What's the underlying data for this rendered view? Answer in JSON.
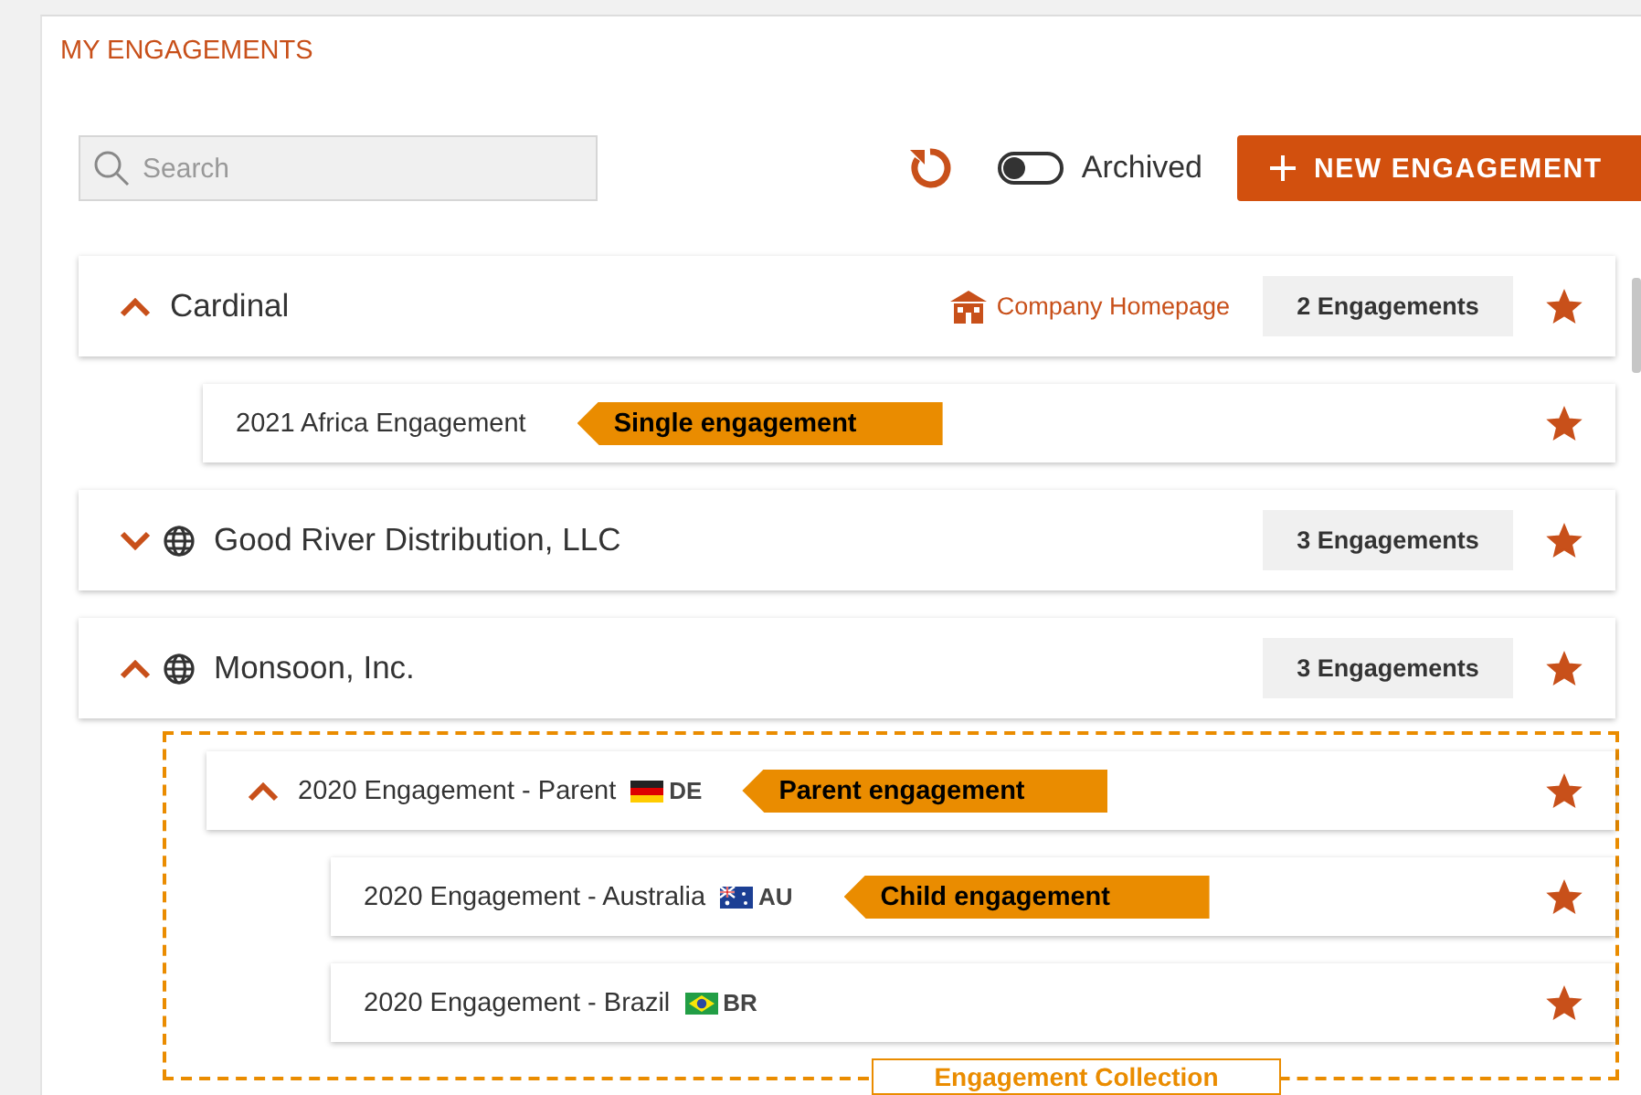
{
  "title": "MY ENGAGEMENTS",
  "toolbar": {
    "search": {
      "placeholder": "Search"
    },
    "archived": {
      "label": "Archived",
      "on": false
    },
    "new_button": "NEW ENGAGEMENT"
  },
  "companies": [
    {
      "name": "Cardinal",
      "expanded": true,
      "globe": false,
      "homepage": "Company Homepage",
      "count": "2 Engagements",
      "starred": true,
      "grouped": false,
      "engagements": [
        {
          "name": "2021 Africa Engagement",
          "starred": true,
          "callout": "Single engagement"
        }
      ]
    },
    {
      "name": "Good River Distribution, LLC",
      "expanded": false,
      "globe": true,
      "count": "3 Engagements",
      "starred": true,
      "grouped": false
    },
    {
      "name": "Monsoon, Inc.",
      "expanded": true,
      "globe": true,
      "count": "3 Engagements",
      "starred": true,
      "grouped": true,
      "group_label": "Engagement Collection",
      "engagements": [
        {
          "name": "2020 Engagement - Parent",
          "starred": true,
          "expanded": true,
          "flag": {
            "kind": "de",
            "code": "DE"
          },
          "callout": "Parent engagement",
          "children": [
            {
              "name": "2020 Engagement - Australia",
              "starred": true,
              "flag": {
                "kind": "au",
                "code": "AU"
              },
              "callout": "Child engagement"
            },
            {
              "name": "2020 Engagement - Brazil",
              "starred": true,
              "flag": {
                "kind": "br",
                "code": "BR"
              }
            }
          ]
        }
      ]
    }
  ]
}
